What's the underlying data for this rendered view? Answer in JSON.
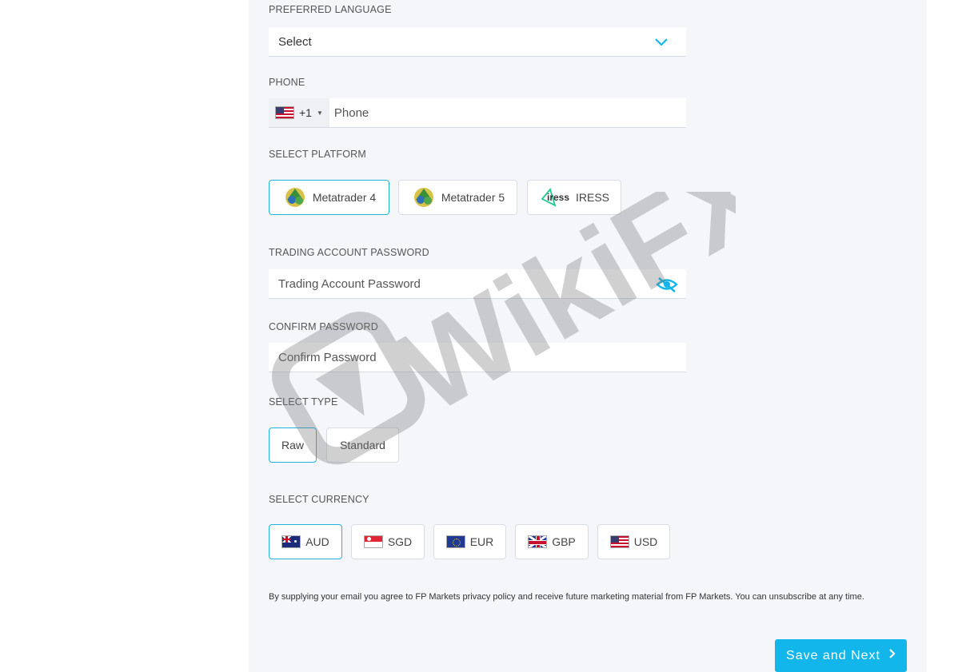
{
  "language": {
    "label": "PREFERRED LANGUAGE",
    "value": "Select"
  },
  "phone": {
    "label": "PHONE",
    "country_code": "+1",
    "placeholder": "Phone"
  },
  "platform": {
    "label": "SELECT PLATFORM",
    "options": [
      {
        "label": "Metatrader 4",
        "selected": true
      },
      {
        "label": "Metatrader 5",
        "selected": false
      },
      {
        "label": "IRESS",
        "logo_text": "iress",
        "selected": false
      }
    ]
  },
  "trading_password": {
    "label": "TRADING ACCOUNT PASSWORD",
    "placeholder": "Trading Account Password"
  },
  "confirm_password": {
    "label": "CONFIRM PASSWORD",
    "placeholder": "Confirm Password"
  },
  "account_type": {
    "label": "SELECT TYPE",
    "options": [
      {
        "label": "Raw",
        "selected": true
      },
      {
        "label": "Standard",
        "selected": false
      }
    ]
  },
  "currency": {
    "label": "SELECT CURRENCY",
    "options": [
      {
        "label": "AUD",
        "flag": "australia-flag",
        "selected": true
      },
      {
        "label": "SGD",
        "flag": "singapore-flag",
        "selected": false
      },
      {
        "label": "EUR",
        "flag": "eu-flag",
        "selected": false
      },
      {
        "label": "GBP",
        "flag": "uk-flag",
        "selected": false
      },
      {
        "label": "USD",
        "flag": "us-flag",
        "selected": false
      }
    ]
  },
  "disclaimer": "By supplying your email you agree to FP Markets privacy policy and receive future marketing material from FP Markets. You can unsubscribe at any time.",
  "save_button": {
    "label": "Save and Next"
  },
  "watermark": {
    "text": "WikiFX"
  },
  "colors": {
    "accent": "#12b6ea",
    "selected_border": "#1fb4dc",
    "panel_bg": "#f4f6fa"
  }
}
